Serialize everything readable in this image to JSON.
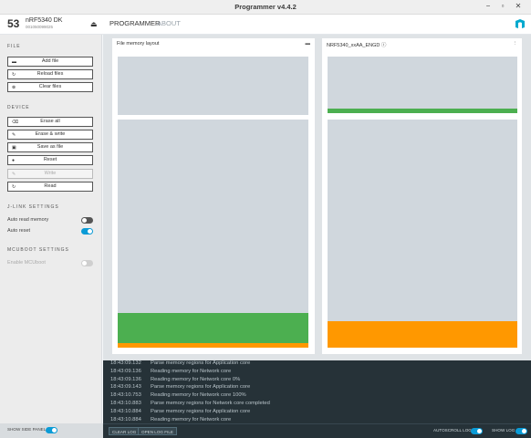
{
  "window": {
    "title": "Programmer v4.4.2"
  },
  "device": {
    "number": "53",
    "name": "nRF5340 DK",
    "serial": "001050099025"
  },
  "nav": {
    "programmer": "PROGRAMMER",
    "about": "ABOUT"
  },
  "sidebar": {
    "file": {
      "title": "FILE",
      "add_file": "Add file",
      "reload_files": "Reload files",
      "clear_files": "Clear files"
    },
    "device": {
      "title": "DEVICE",
      "erase_all": "Erase all",
      "erase_write": "Erase & write",
      "save_as_file": "Save as file",
      "reset": "Reset",
      "write": "Write",
      "read": "Read"
    },
    "jlink": {
      "title": "J-LINK SETTINGS",
      "auto_read_memory": {
        "label": "Auto read memory",
        "enabled": false
      },
      "auto_reset": {
        "label": "Auto reset",
        "enabled": true
      }
    },
    "mcuboot": {
      "title": "MCUBOOT SETTINGS",
      "enable_mcuboot": {
        "label": "Enable MCUboot",
        "enabled": false
      }
    }
  },
  "panels": {
    "file_memory": {
      "title": "File memory layout"
    },
    "device_memory": {
      "title": "NRF5340_xxAA_ENGD"
    }
  },
  "colors": {
    "green": "#4caf50",
    "orange": "#ff9800",
    "region": "#d0d7dd",
    "accent": "#0a9bd6"
  },
  "log": {
    "lines": [
      {
        "time": "18:43:09.132",
        "msg": "Parse memory regions for Application core"
      },
      {
        "time": "18:43:09.136",
        "msg": "Reading memory for Network core"
      },
      {
        "time": "18:43:09.136",
        "msg": "Reading memory for Network core 0%"
      },
      {
        "time": "18:43:09.143",
        "msg": "Parse memory regions for Application core"
      },
      {
        "time": "18:43:10.753",
        "msg": "Reading memory for Network core 100%"
      },
      {
        "time": "18:43:10.883",
        "msg": "Parse memory regions for Network core completed"
      },
      {
        "time": "18:43:10.884",
        "msg": "Parse memory regions for Application core"
      },
      {
        "time": "18:43:10.884",
        "msg": "Reading memory for Network core"
      }
    ]
  },
  "footer": {
    "show_side_panel": "SHOW SIDE PANEL",
    "clear_log": "CLEAR LOG",
    "open_log_file": "OPEN LOG FILE",
    "autoscroll_log": "AUTOSCROLL LOG",
    "show_log": "SHOW LOG"
  }
}
